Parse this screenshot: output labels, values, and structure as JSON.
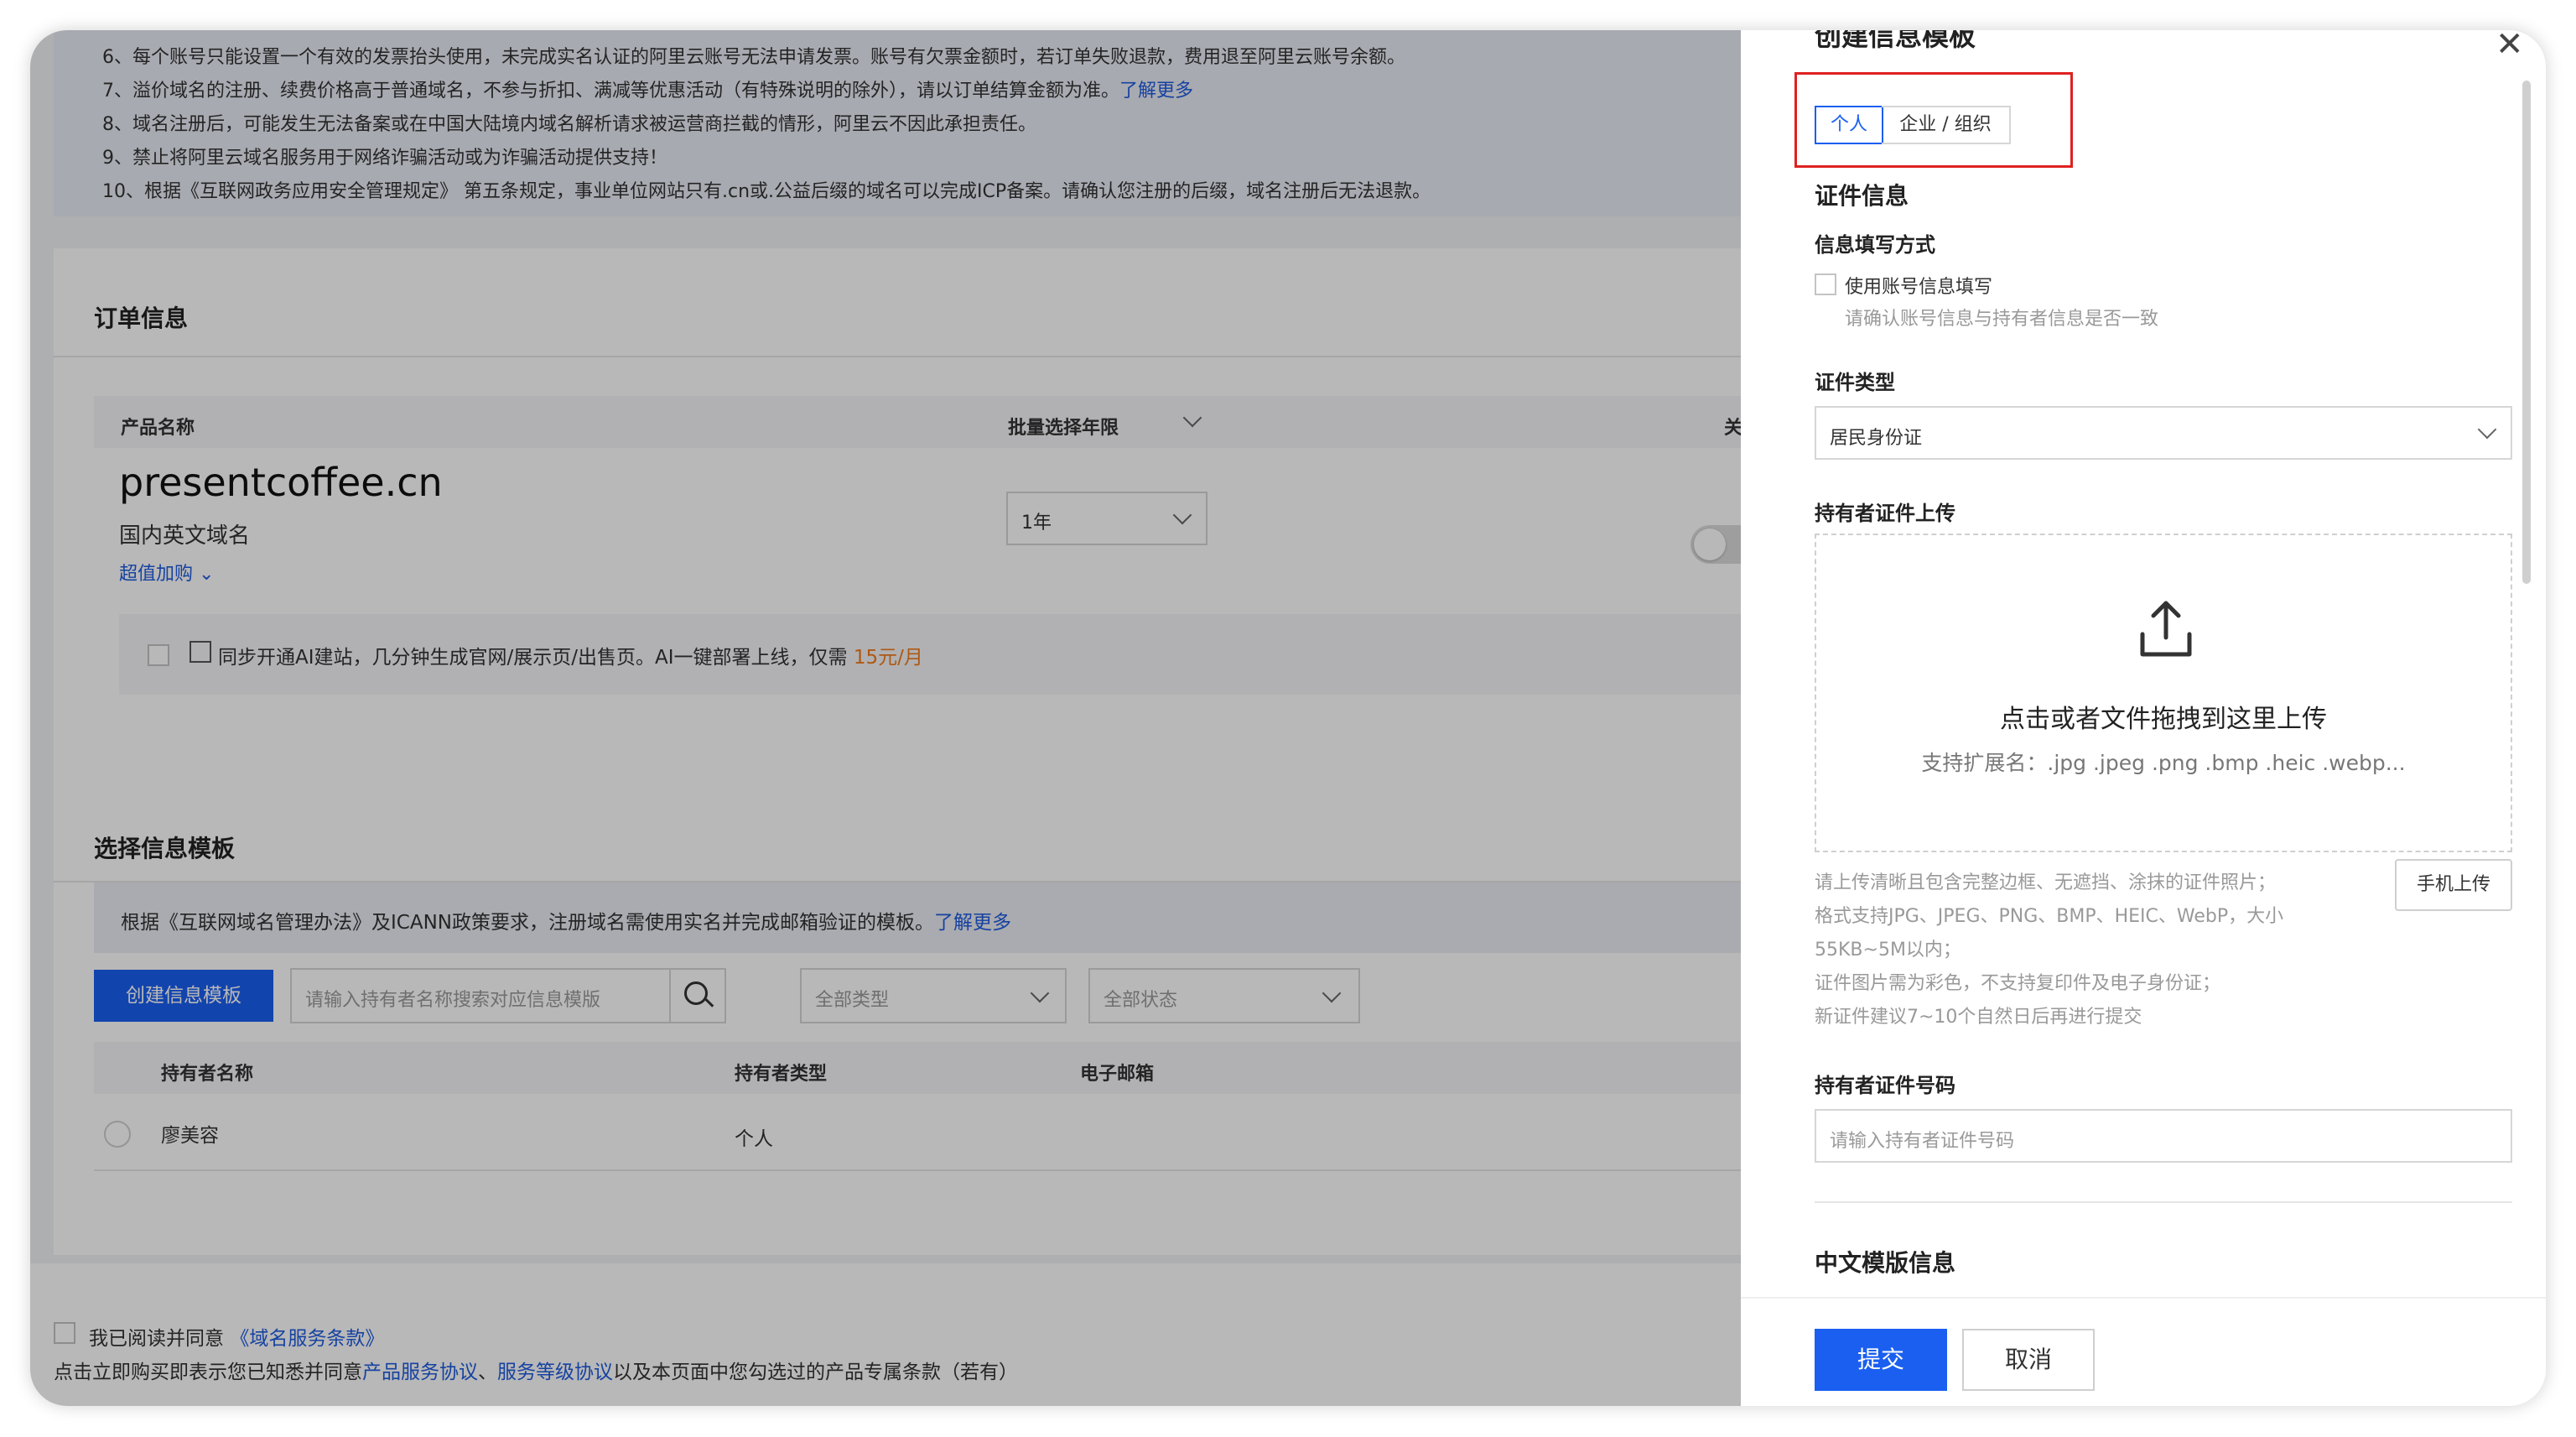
{
  "notice": {
    "lines": [
      "6、每个账号只能设置一个有效的发票抬头使用，未完成实名认证的阿里云账号无法申请发票。账号有欠票金额时，若订单失败退款，费用退至阿里云账号余额。",
      "7、溢价域名的注册、续费价格高于普通域名，不参与折扣、满减等优惠活动（有特殊说明的除外），请以订单结算金额为准。",
      "8、域名注册后，可能发生无法备案或在中国大陆境内域名解析请求被运营商拦截的情形，阿里云不因此承担责任。",
      "9、禁止将阿里云域名服务用于网络诈骗活动或为诈骗活动提供支持！",
      "10、根据《互联网政务应用安全管理规定》 第五条规定，事业单位网站只有.cn或.公益后缀的域名可以完成ICP备案。请确认您注册的后缀，域名注册后无法退款。"
    ],
    "learn_more": "了解更多"
  },
  "order": {
    "title": "订单信息",
    "col_product": "产品名称",
    "col_years": "批量选择年限",
    "col_auto": "关闭自动续",
    "domain": "presentcoffee.cn",
    "domain_type": "国内英文域名",
    "addon": "超值加购",
    "year_value": "1年",
    "ai_text": "同步开通AI建站，几分钟生成官网/展示页/出售页。AI一键部署上线，仅需",
    "ai_price": "15元/月"
  },
  "template": {
    "title": "选择信息模板",
    "tip": "根据《互联网域名管理办法》及ICANN政策要求，注册域名需使用实名并完成邮箱验证的模板。",
    "tip_link": "了解更多",
    "create_btn": "创建信息模板",
    "search_placeholder": "请输入持有者名称搜索对应信息模版",
    "type_select": "全部类型",
    "status_select": "全部状态",
    "col_name": "持有者名称",
    "col_type": "持有者类型",
    "col_email": "电子邮箱",
    "row_name": "廖美容",
    "row_type": "个人"
  },
  "footer": {
    "agree_text": "我已阅读并同意",
    "agree_link": "《域名服务条款》",
    "legal_prefix": "点击立即购买即表示您已知悉并同意",
    "legal_link1": "产品服务协议",
    "legal_sep": "、",
    "legal_link2": "服务等级协议",
    "legal_suffix": "以及本页面中您勾选过的产品专属条款（若有）"
  },
  "panel": {
    "title": "创建信息模板",
    "tab_personal": "个人",
    "tab_org": "企业 / 组织",
    "section_cert": "证件信息",
    "fill_method_label": "信息填写方式",
    "use_account": "使用账号信息填写",
    "use_account_hint": "请确认账号信息与持有者信息是否一致",
    "cert_type_label": "证件类型",
    "cert_type_value": "居民身份证",
    "upload_label": "持有者证件上传",
    "upload_main": "点击或者文件拖拽到这里上传",
    "upload_ext": "支持扩展名：.jpg .jpeg .png .bmp .heic .webp...",
    "upload_notes": [
      "请上传清晰且包含完整边框、无遮挡、涂抹的证件照片；",
      "格式支持JPG、JPEG、PNG、BMP、HEIC、WebP，大小",
      "55KB~5M以内；",
      "证件图片需为彩色，不支持复印件及电子身份证；",
      "新证件建议7~10个自然日后再进行提交"
    ],
    "mobile_upload": "手机上传",
    "cert_no_label": "持有者证件号码",
    "cert_no_placeholder": "请输入持有者证件号码",
    "cn_section": "中文模版信息",
    "submit": "提交",
    "cancel": "取消"
  },
  "colors": {
    "primary": "#1a5ff0",
    "highlight_box": "#e02020",
    "price": "#f07c1c"
  }
}
